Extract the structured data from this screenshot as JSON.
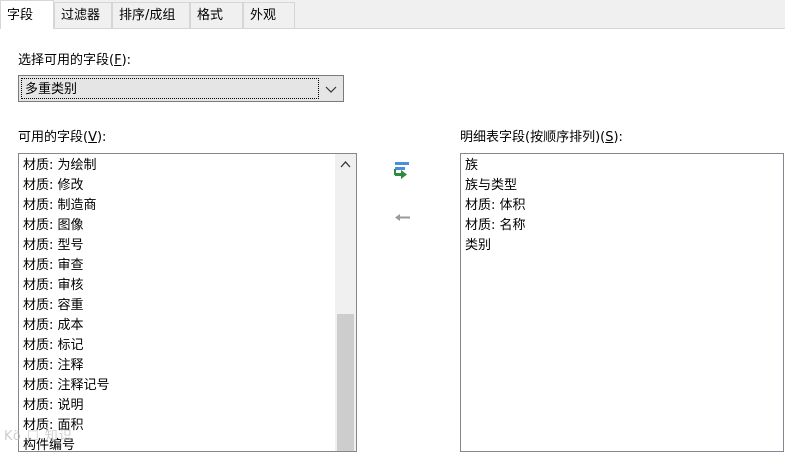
{
  "tabs": [
    {
      "label": "字段"
    },
    {
      "label": "过滤器"
    },
    {
      "label": "排序/成组"
    },
    {
      "label": "格式"
    },
    {
      "label": "外观"
    }
  ],
  "select_fields_from": {
    "label": "选择可用的字段(",
    "accel": "F",
    "suffix": "):",
    "value": "多重类别"
  },
  "available_fields": {
    "label": "可用的字段(",
    "accel": "V",
    "suffix": "):",
    "items": [
      "材质: 为绘制",
      "材质: 修改",
      "材质: 制造商",
      "材质: 图像",
      "材质: 型号",
      "材质: 审查",
      "材质: 审核",
      "材质: 容重",
      "材质: 成本",
      "材质: 标记",
      "材质: 注释",
      "材质: 注释记号",
      "材质: 说明",
      "材质: 面积",
      "构件编号"
    ]
  },
  "schedule_fields": {
    "label": "明细表字段(按顺序排列)(",
    "accel": "S",
    "suffix": "):",
    "items": [
      "族",
      "族与类型",
      "材质: 体积",
      "材质: 名称",
      "类别"
    ]
  },
  "buttons": {
    "add_icon": "add-parameter-icon",
    "remove_icon": "remove-parameter-icon"
  },
  "watermark": "Kö  ☐ 知识"
}
